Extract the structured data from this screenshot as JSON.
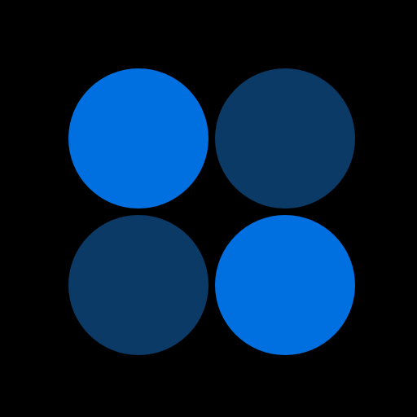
{
  "background_color": "#000000",
  "circles": [
    {
      "id": "top-left",
      "color": "#0070E0",
      "shade": "bright"
    },
    {
      "id": "top-right",
      "color": "#0C3A66",
      "shade": "dark"
    },
    {
      "id": "bottom-left",
      "color": "#0C3A66",
      "shade": "dark"
    },
    {
      "id": "bottom-right",
      "color": "#0070E0",
      "shade": "bright"
    }
  ]
}
